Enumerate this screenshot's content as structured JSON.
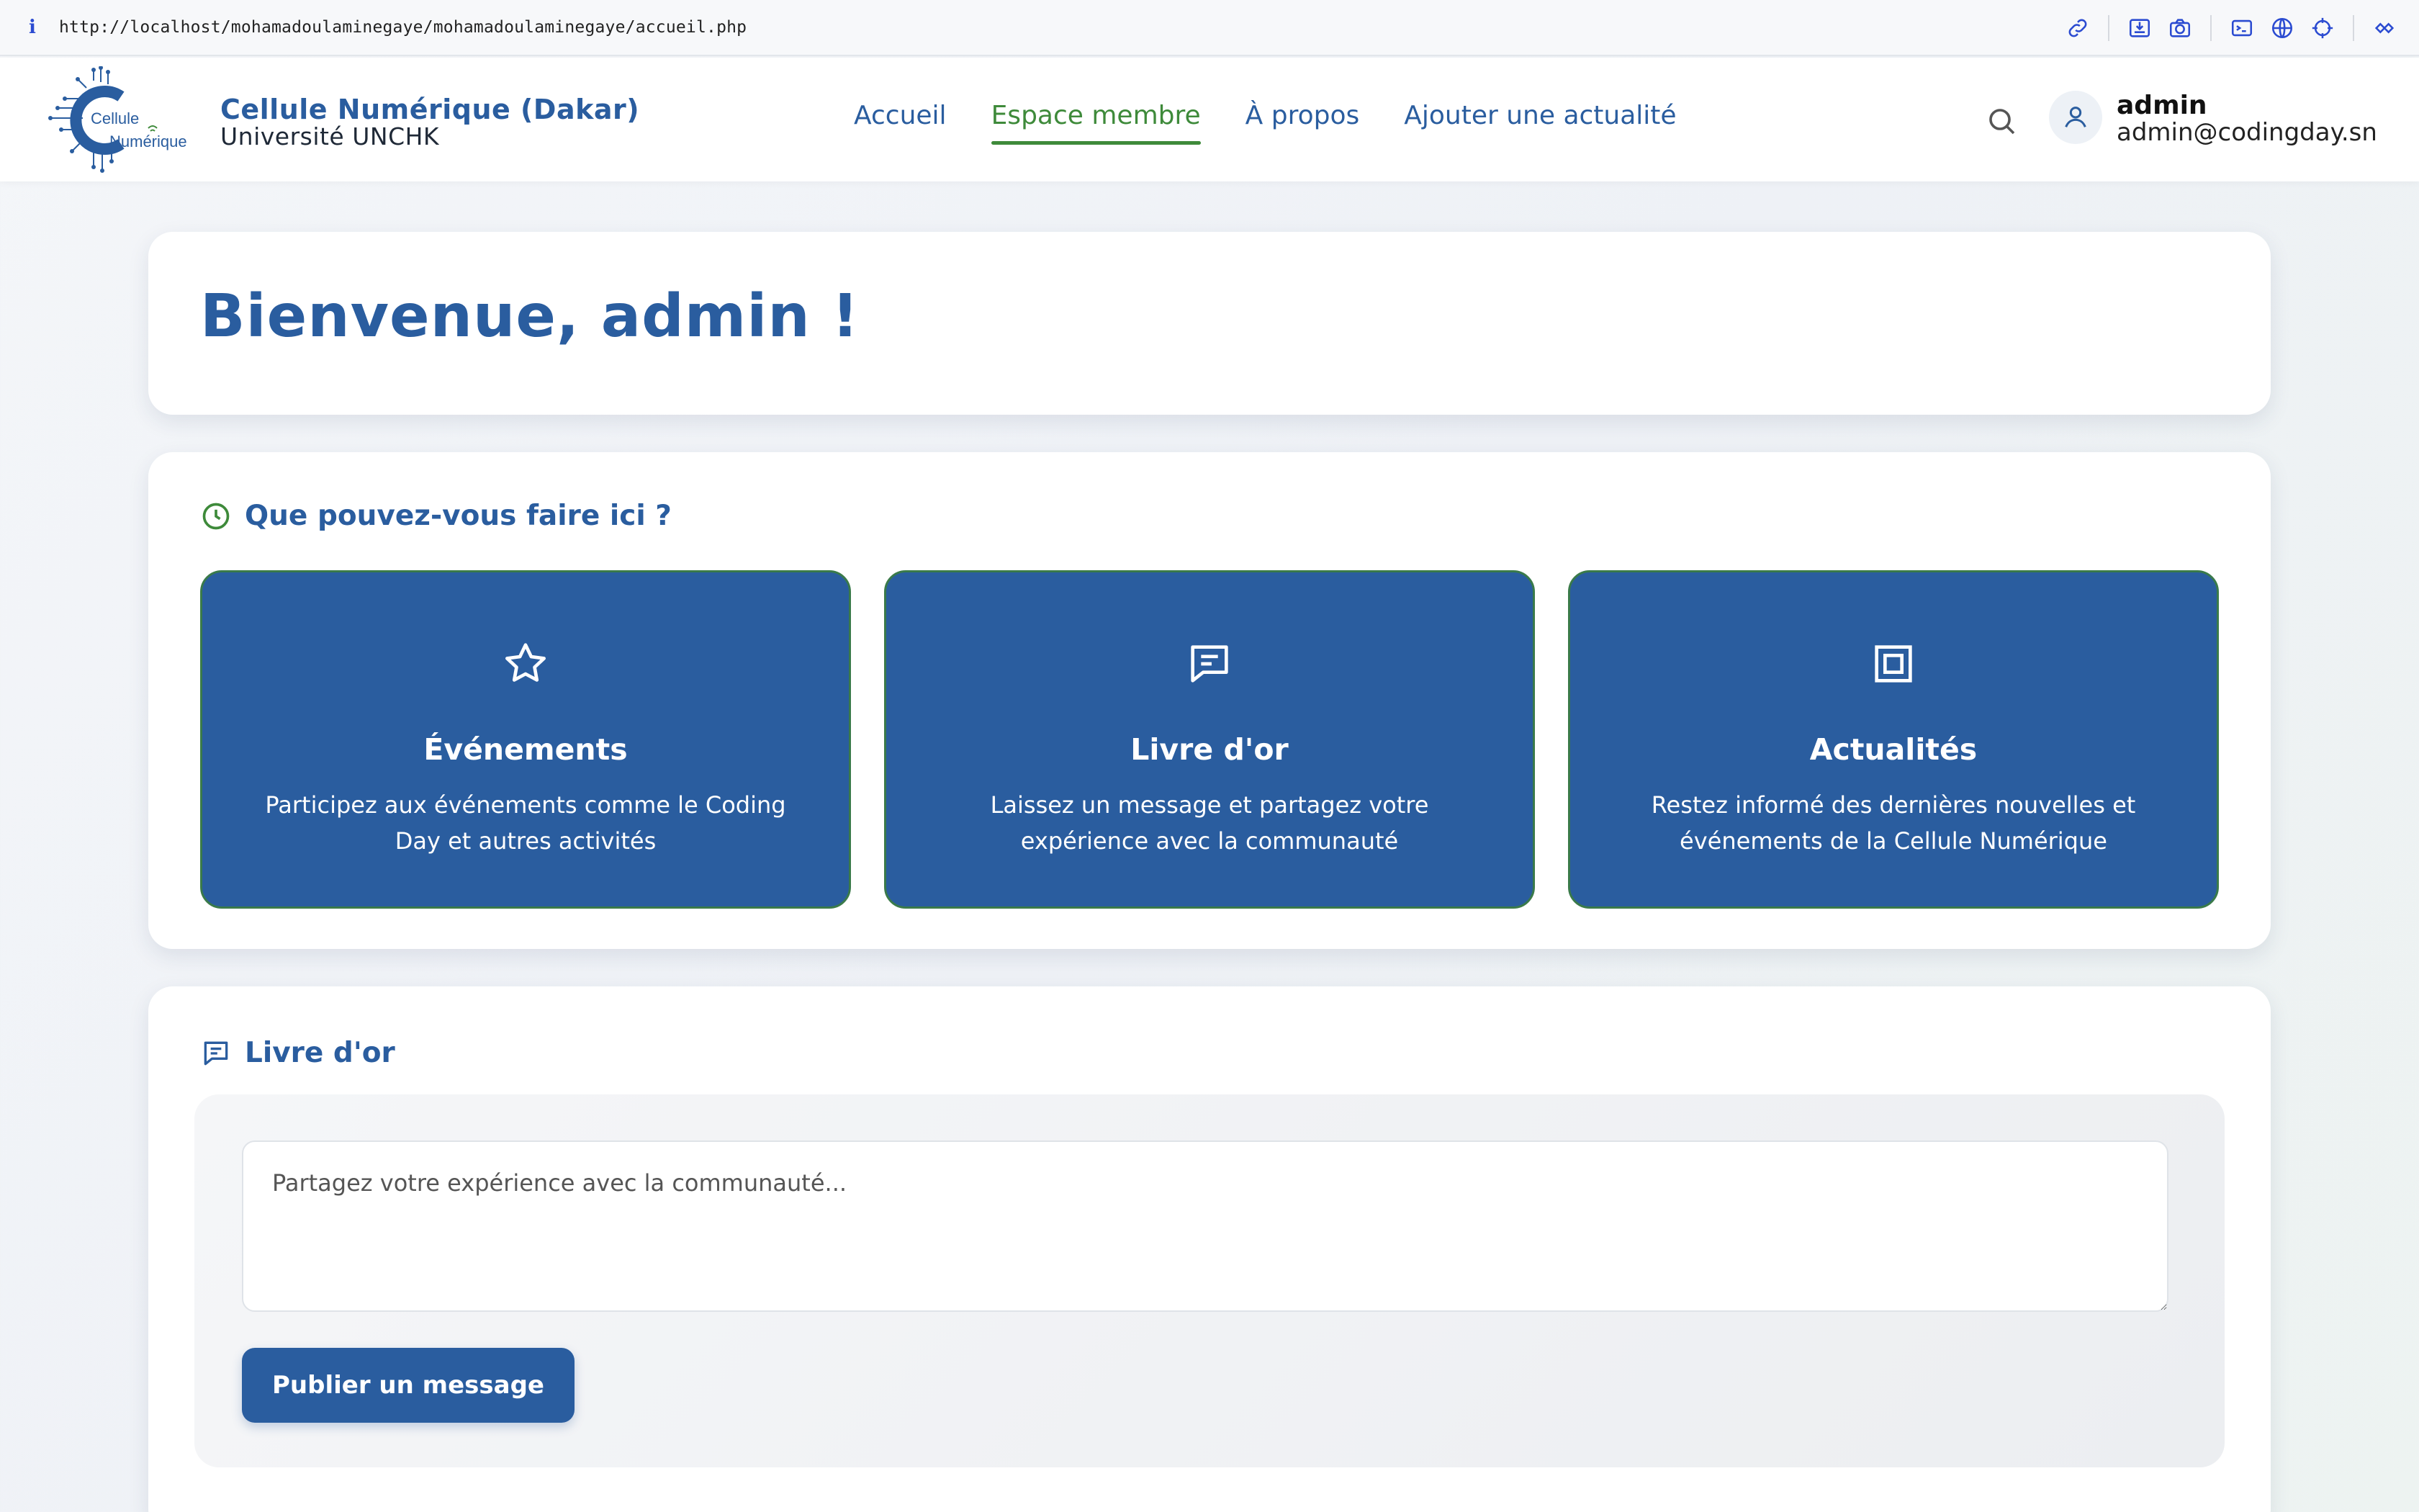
{
  "browser": {
    "url": "http://localhost/mohamadoulaminegaye/mohamadoulaminegaye/accueil.php",
    "info_glyph": "i",
    "icons": [
      "link-icon",
      "save-icon",
      "camera-icon",
      "terminal-icon",
      "globe-icon",
      "crosshair-icon",
      "extensions-icon"
    ]
  },
  "header": {
    "logo": {
      "line1": "Cellule",
      "line2": "Numérique"
    },
    "brand_title": "Cellule Numérique (Dakar)",
    "brand_subtitle": "Université UNCHK",
    "nav": [
      {
        "label": "Accueil",
        "active": false
      },
      {
        "label": "Espace membre",
        "active": true
      },
      {
        "label": "À propos",
        "active": false
      },
      {
        "label": "Ajouter une actualité",
        "active": false
      }
    ],
    "user": {
      "name": "admin",
      "email": "admin@codingday.sn"
    }
  },
  "welcome": {
    "title": "Bienvenue, admin !"
  },
  "features": {
    "heading": "Que pouvez-vous faire ici ?",
    "items": [
      {
        "icon": "star-icon",
        "title": "Événements",
        "desc": "Participez aux événements comme le Coding Day et autres activités"
      },
      {
        "icon": "message-icon",
        "title": "Livre d'or",
        "desc": "Laissez un message et partagez votre expérience avec la communauté"
      },
      {
        "icon": "news-icon",
        "title": "Actualités",
        "desc": "Restez informé des dernières nouvelles et événements de la Cellule Numérique"
      }
    ]
  },
  "guestbook": {
    "heading": "Livre d'or",
    "placeholder": "Partagez votre expérience avec la communauté...",
    "value": "",
    "button_label": "Publier un message"
  },
  "colors": {
    "primary": "#2a5d9f",
    "accent": "#3e8a3a",
    "card_border": "#3a7a4a"
  }
}
